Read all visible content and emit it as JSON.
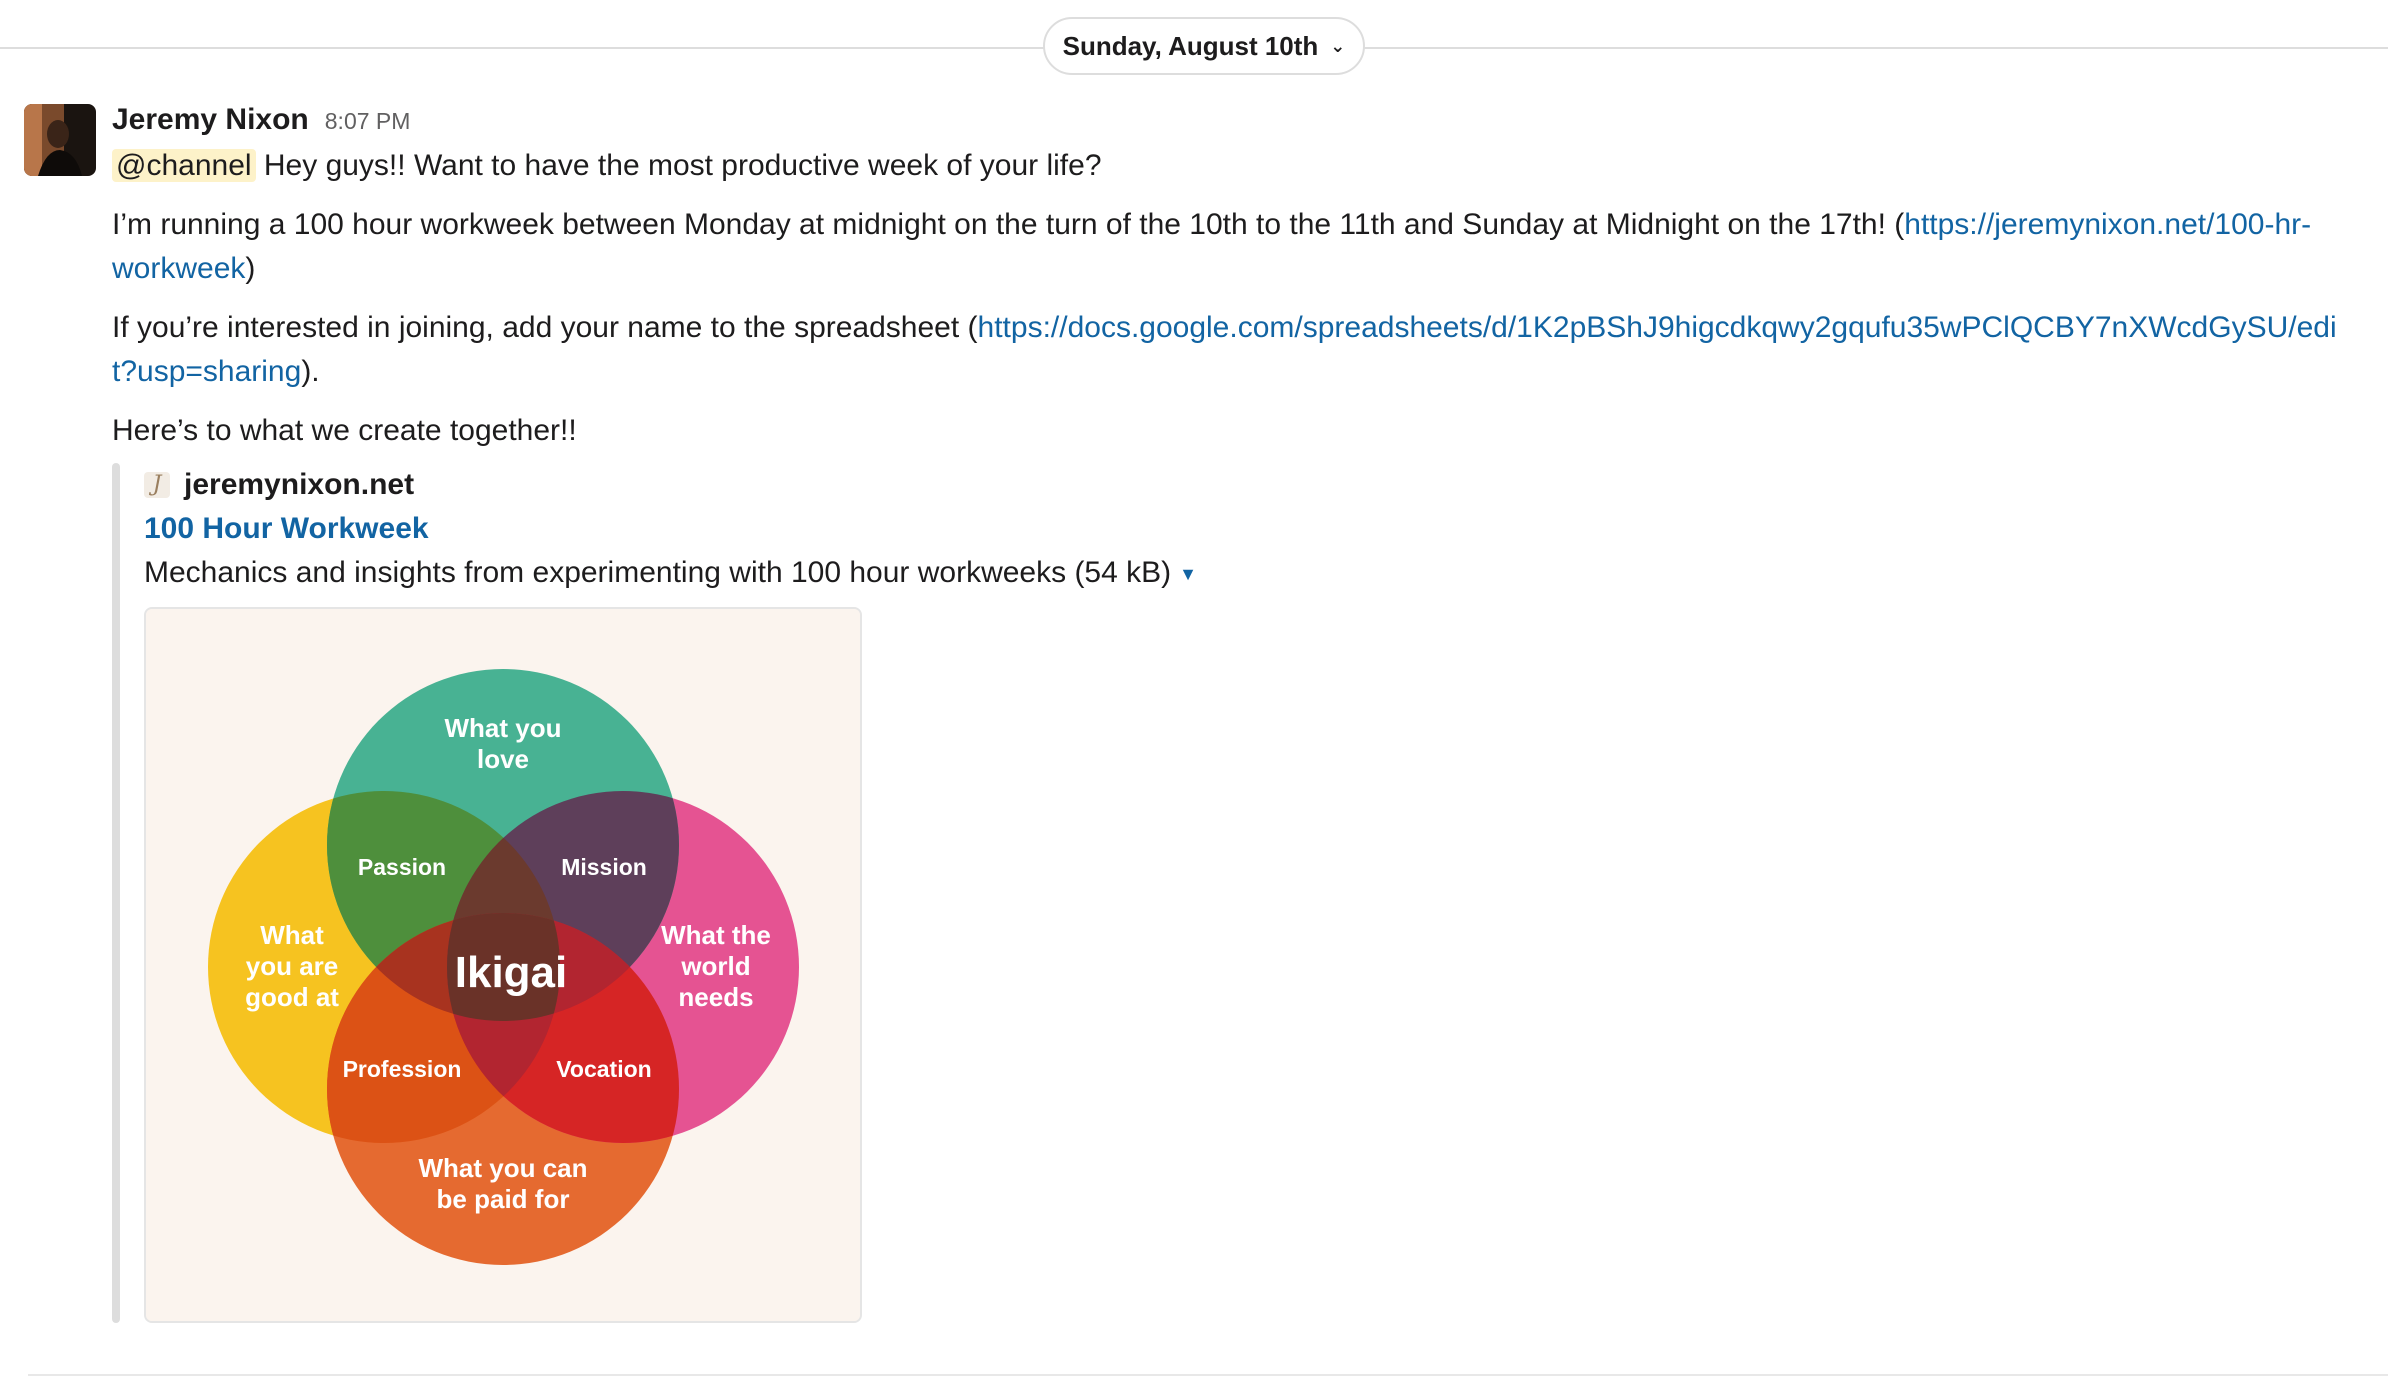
{
  "date_divider": {
    "label": "Sunday, August 10th"
  },
  "message": {
    "author": "Jeremy Nixon",
    "time": "8:07 PM",
    "mention": "@channel",
    "line1": " Hey guys!! Want to have the most productive week of your life?",
    "para2_text": "I’m running a 100 hour workweek between Monday at midnight on the turn of the 10th to the 11th and Sunday at Midnight on the 17th! (",
    "para2_link": "https://jeremynixon.net/100-hr-workweek",
    "para2_end": ")",
    "para3_text": "If you’re interested in joining, add your name to the spreadsheet (",
    "para3_link": "https://docs.google.com/spreadsheets/d/1K2pBShJ9higcdkqwy2gqufu35wPClQCBY7nXWcdGySU/edit?usp=sharing",
    "para3_end": ").",
    "para4": "Here’s to what we create together!!"
  },
  "attachment": {
    "site": "jeremynixon.net",
    "title": "100 Hour Workweek",
    "description": "Mechanics and insights from experimenting with 100 hour workweeks (54 kB)",
    "image": {
      "center_label": "Ikigai",
      "circles": {
        "top": "What you love",
        "left": "What you are good at",
        "right": "What the world needs",
        "bottom": "What you can be paid for"
      },
      "overlaps": {
        "passion": "Passion",
        "mission": "Mission",
        "profession": "Profession",
        "vocation": "Vocation"
      },
      "colors": {
        "top": "#2fa886",
        "left": "#f6c320",
        "right": "#e3448a",
        "bottom": "#e35d20",
        "background": "#fbf4ee"
      }
    }
  }
}
